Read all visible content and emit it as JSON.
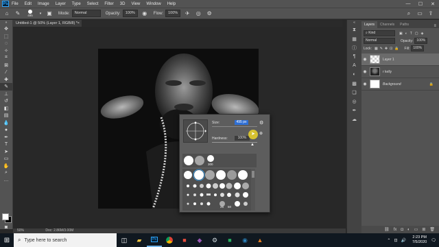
{
  "menubar": {
    "logo": "Ps",
    "items": [
      "File",
      "Edit",
      "Image",
      "Layer",
      "Type",
      "Select",
      "Filter",
      "3D",
      "View",
      "Window",
      "Help"
    ],
    "window_controls": [
      "—",
      "☐",
      "✕"
    ]
  },
  "options": {
    "brush_size": "495",
    "mode_label": "Mode:",
    "mode_value": "Normal",
    "opacity_label": "Opacity:",
    "opacity_value": "100%",
    "flow_label": "Flow:",
    "flow_value": "100%"
  },
  "document": {
    "tab_title": "Untitled-1 @ 50% (Layer 1, RGB/8) *",
    "close": "×",
    "zoom": "50%",
    "doc_info": "Doc: 2.86M/3.00M"
  },
  "brush_popup": {
    "size_label": "Size:",
    "size_value": "495 px",
    "hardness_label": "Hardness:",
    "hardness_value": "100%",
    "recent_size_label": "300",
    "preset_labels": [
      "25",
      "50"
    ]
  },
  "layers_panel": {
    "tabs": [
      "Layers",
      "Channels",
      "Paths"
    ],
    "filter_label": "Kind",
    "blend_mode": "Normal",
    "opacity_label": "Opacity:",
    "opacity_value": "100%",
    "lock_label": "Lock:",
    "fill_label": "Fill:",
    "fill_value": "100%",
    "layers": [
      {
        "name": "Layer 1",
        "selected": true,
        "thumb": "checker"
      },
      {
        "name": "r kelly",
        "selected": false,
        "thumb": "photo"
      },
      {
        "name": "Background",
        "selected": false,
        "thumb": "white",
        "locked": true
      }
    ]
  },
  "taskbar": {
    "search_placeholder": "Type here to search",
    "time": "2:23 PM",
    "date": "7/5/2020"
  },
  "colors": {
    "foreground": "#ffffff",
    "background": "#000000",
    "accent": "#2f6fd4"
  }
}
